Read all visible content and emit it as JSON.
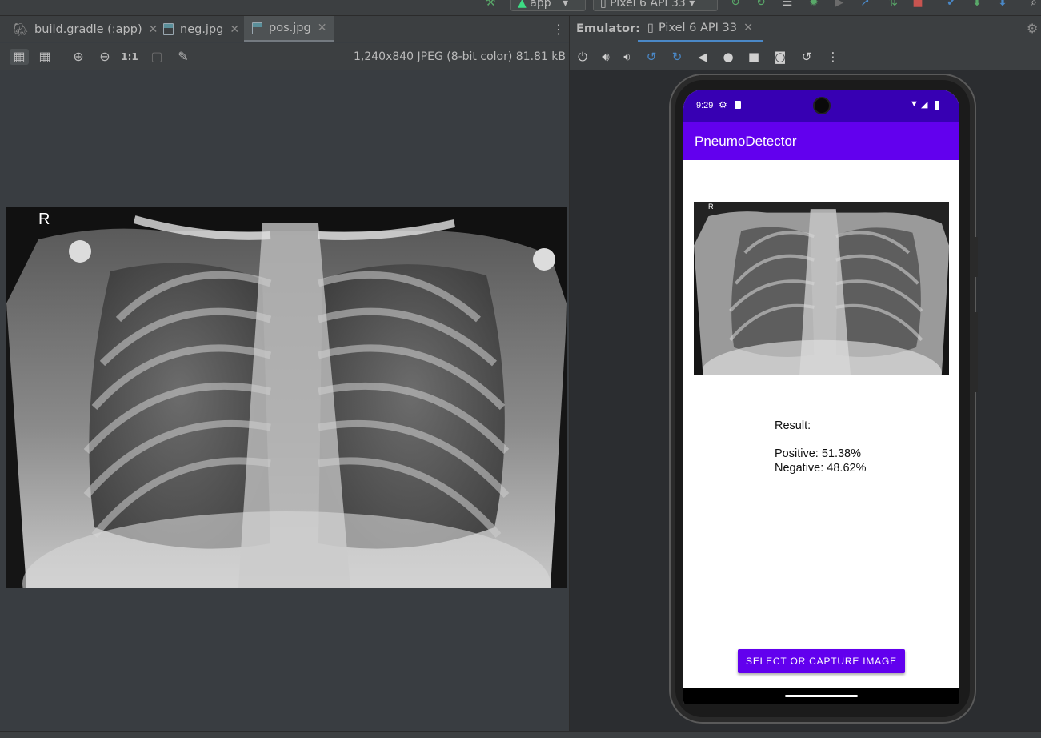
{
  "toolbar": {
    "run_config": "app",
    "device": "Pixel 6 API 33"
  },
  "editor": {
    "tabs": [
      {
        "label": "build.gradle (:app)"
      },
      {
        "label": "neg.jpg"
      },
      {
        "label": "pos.jpg"
      }
    ],
    "zoom_actual": "1:1",
    "image_info": "1,240x840 JPEG (8-bit color) 81.81 kB",
    "xray_marker": "R"
  },
  "emulator": {
    "label": "Emulator:",
    "tab": "Pixel 6 API 33"
  },
  "phone": {
    "time": "9:29",
    "app_title": "PneumoDetector",
    "result_label": "Result:",
    "positive": "Positive: 51.38%",
    "negative": "Negative: 48.62%",
    "button": "SELECT OR CAPTURE IMAGE",
    "xray_marker": "R"
  },
  "colors": {
    "app_bar": "#6200ee",
    "status_bar": "#3700b3",
    "ide_bg": "#3c3f41"
  }
}
